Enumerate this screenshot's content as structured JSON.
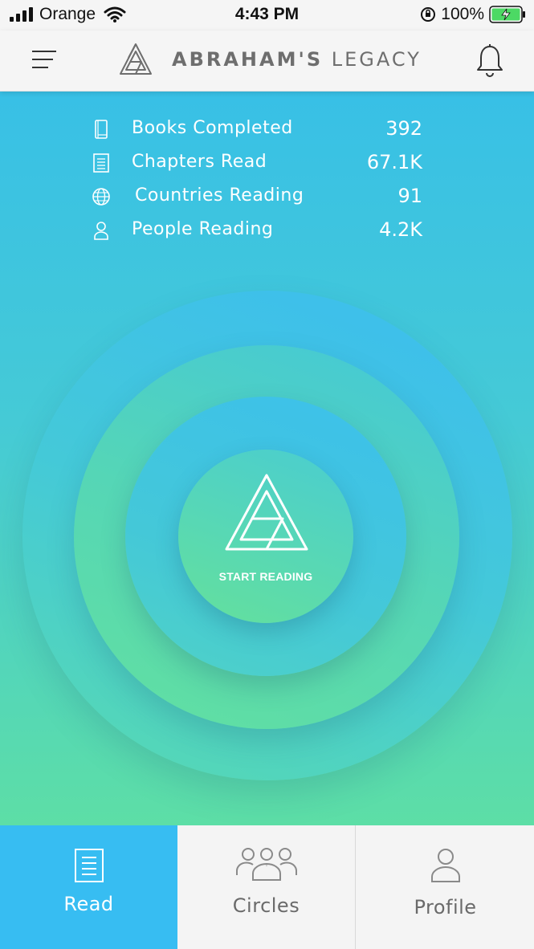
{
  "status_bar": {
    "carrier": "Orange",
    "time": "4:43 PM",
    "battery_percent": "100%"
  },
  "header": {
    "brand_bold": "ABRAHAM'S",
    "brand_light": "LEGACY",
    "menu_icon": "menu-icon",
    "notification_icon": "bell-icon"
  },
  "stats": [
    {
      "icon": "book-icon",
      "label": "Books Completed",
      "value": "392"
    },
    {
      "icon": "document-icon",
      "label": "Chapters Read",
      "value": "67.1K"
    },
    {
      "icon": "globe-icon",
      "label": "Countries Reading",
      "value": "91"
    },
    {
      "icon": "person-icon",
      "label": "People Reading",
      "value": "4.2K"
    }
  ],
  "start_button": {
    "label": "START READING",
    "icon": "brand-logo-icon"
  },
  "tabs": [
    {
      "label": "Read",
      "icon": "document-icon",
      "active": true
    },
    {
      "label": "Circles",
      "icon": "group-icon",
      "active": false
    },
    {
      "label": "Profile",
      "icon": "person-icon",
      "active": false
    }
  ],
  "colors": {
    "accent": "#37bdf2",
    "gradient_top": "#38c0e6",
    "gradient_bottom": "#5ddea6",
    "header_bg": "#f5f5f5",
    "tabbar_bg": "#f4f4f4"
  }
}
